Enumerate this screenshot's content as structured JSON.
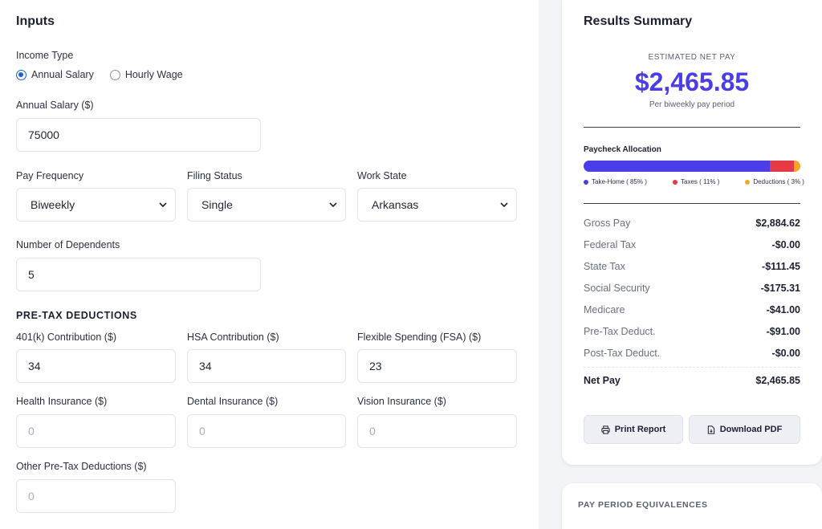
{
  "inputs": {
    "title": "Inputs",
    "income_type": {
      "label": "Income Type",
      "options": [
        "Annual Salary",
        "Hourly Wage"
      ],
      "selected": "Annual Salary"
    },
    "annual_salary": {
      "label": "Annual Salary ($)",
      "value": "75000"
    },
    "pay_frequency": {
      "label": "Pay Frequency",
      "value": "Biweekly"
    },
    "filing_status": {
      "label": "Filing Status",
      "value": "Single"
    },
    "work_state": {
      "label": "Work State",
      "value": "Arkansas"
    },
    "dependents": {
      "label": "Number of Dependents",
      "value": "5"
    },
    "pretax": {
      "title": "PRE-TAX DEDUCTIONS",
      "k401": {
        "label": "401(k) Contribution ($)",
        "value": "34"
      },
      "hsa": {
        "label": "HSA Contribution ($)",
        "value": "34"
      },
      "fsa": {
        "label": "Flexible Spending (FSA) ($)",
        "value": "23"
      },
      "health": {
        "label": "Health Insurance ($)",
        "placeholder": "0"
      },
      "dental": {
        "label": "Dental Insurance ($)",
        "placeholder": "0"
      },
      "vision": {
        "label": "Vision Insurance ($)",
        "placeholder": "0"
      },
      "other": {
        "label": "Other Pre-Tax Deductions ($)",
        "placeholder": "0"
      }
    }
  },
  "results": {
    "title": "Results Summary",
    "estimated_label": "ESTIMATED NET PAY",
    "net_pay": "$2,465.85",
    "per_period": "Per biweekly pay period",
    "allocation": {
      "title": "Paycheck Allocation",
      "segments": [
        {
          "name": "Take-Home",
          "label": "Take-Home ( 85% )",
          "percent": 85,
          "color": "#4b3ee6"
        },
        {
          "name": "Taxes",
          "label": "Taxes ( 11% )",
          "percent": 11,
          "color": "#e53945"
        },
        {
          "name": "Deductions",
          "label": "Deductions ( 3% )",
          "percent": 3,
          "color": "#f5a623"
        }
      ]
    },
    "breakdown": [
      {
        "label": "Gross Pay",
        "value": "$2,884.62"
      },
      {
        "label": "Federal Tax",
        "value": "-$0.00"
      },
      {
        "label": "State Tax",
        "value": "-$111.45"
      },
      {
        "label": "Social Security",
        "value": "-$175.31"
      },
      {
        "label": "Medicare",
        "value": "-$41.00"
      },
      {
        "label": "Pre-Tax Deduct.",
        "value": "-$91.00"
      },
      {
        "label": "Post-Tax Deduct.",
        "value": "-$0.00"
      }
    ],
    "total": {
      "label": "Net Pay",
      "value": "$2,465.85"
    },
    "print_label": "Print Report",
    "download_label": "Download PDF"
  },
  "equivalences": {
    "title": "PAY PERIOD EQUIVALENCES"
  }
}
